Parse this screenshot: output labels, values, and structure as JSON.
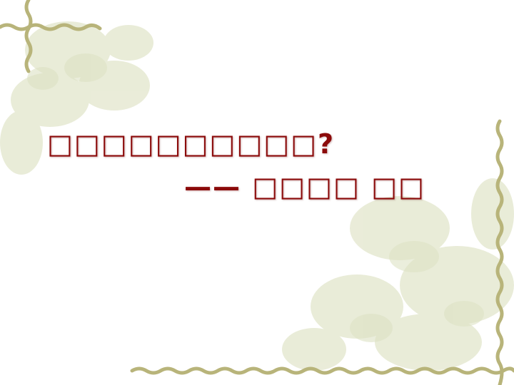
{
  "slide": {
    "title": "□□□□□□□□□□?",
    "subtitle": "—— □□□□ □□"
  },
  "colors": {
    "title_text": "#8b0a0a",
    "frame_vine": "#b8b47a",
    "background_floral": "#e6e9d2"
  },
  "decorations": {
    "top_left": "vine-frame-corner",
    "bottom_right": "vine-frame-corner",
    "background": "faded-lotus-flowers"
  }
}
